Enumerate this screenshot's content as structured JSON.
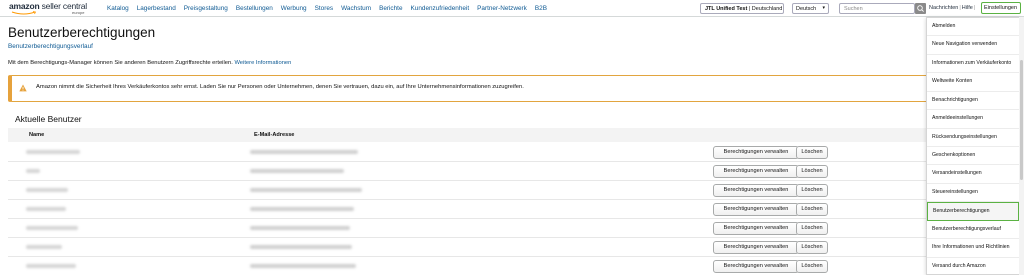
{
  "brand": {
    "logo_main": "amazon",
    "logo_light": " seller central",
    "logo_sub": "europe"
  },
  "nav": [
    "Katalog",
    "Lagerbestand",
    "Preisgestaltung",
    "Bestellungen",
    "Werbung",
    "Stores",
    "Wachstum",
    "Berichte",
    "Kundenzufriedenheit",
    "Partner-Netzwerk",
    "B2B"
  ],
  "header": {
    "account_bold": "JTL Unified Test",
    "account_rest": " | Deutschland",
    "language": "Deutsch",
    "search_placeholder": "Suchen",
    "messages": "Nachrichten",
    "help": "Hilfe",
    "settings": "Einstellungen"
  },
  "page": {
    "title": "Benutzerberechtigungen",
    "subtitle": "Benutzerberechtigungsverlauf",
    "intro_text": "Mit dem Berechtigungs-Manager können Sie anderen Benutzern Zugriffsrechte erteilen.",
    "intro_link": "Weitere Informationen",
    "alert": "Amazon nimmt die Sicherheit Ihres Verkäuferkontos sehr ernst. Laden Sie nur Personen oder Unternehmen, denen Sie vertrauen, dazu ein, auf Ihre Unternehmensinformationen zuzugreifen."
  },
  "users": {
    "section_title": "Aktuelle Benutzer",
    "columns": [
      "Name",
      "E-Mail-Adresse"
    ],
    "manage_label": "Berechtigungen verwalten",
    "delete_label": "Löschen",
    "rows": [
      1,
      2,
      3,
      4,
      5,
      6
    ]
  },
  "settings_menu": [
    "Abmelden",
    "Neue Navigation verwenden",
    "Informationen zum Verkäuferkonto",
    "Weltweite Konten",
    "Benachrichtigungen",
    "Anmeldeeinstellungen",
    "Rücksendungseinstellungen",
    "Geschenkoptionen",
    "Versandeinstellungen",
    "Steuereinstellungen",
    "Benutzerberechtigungen",
    "Benutzerberechtigungsverlauf",
    "Ihre Informationen und Richtlinien",
    "Versand durch Amazon"
  ],
  "colors": {
    "link": "#0e5a93",
    "alert_border": "#e6a23c",
    "highlight": "#5bb243"
  }
}
